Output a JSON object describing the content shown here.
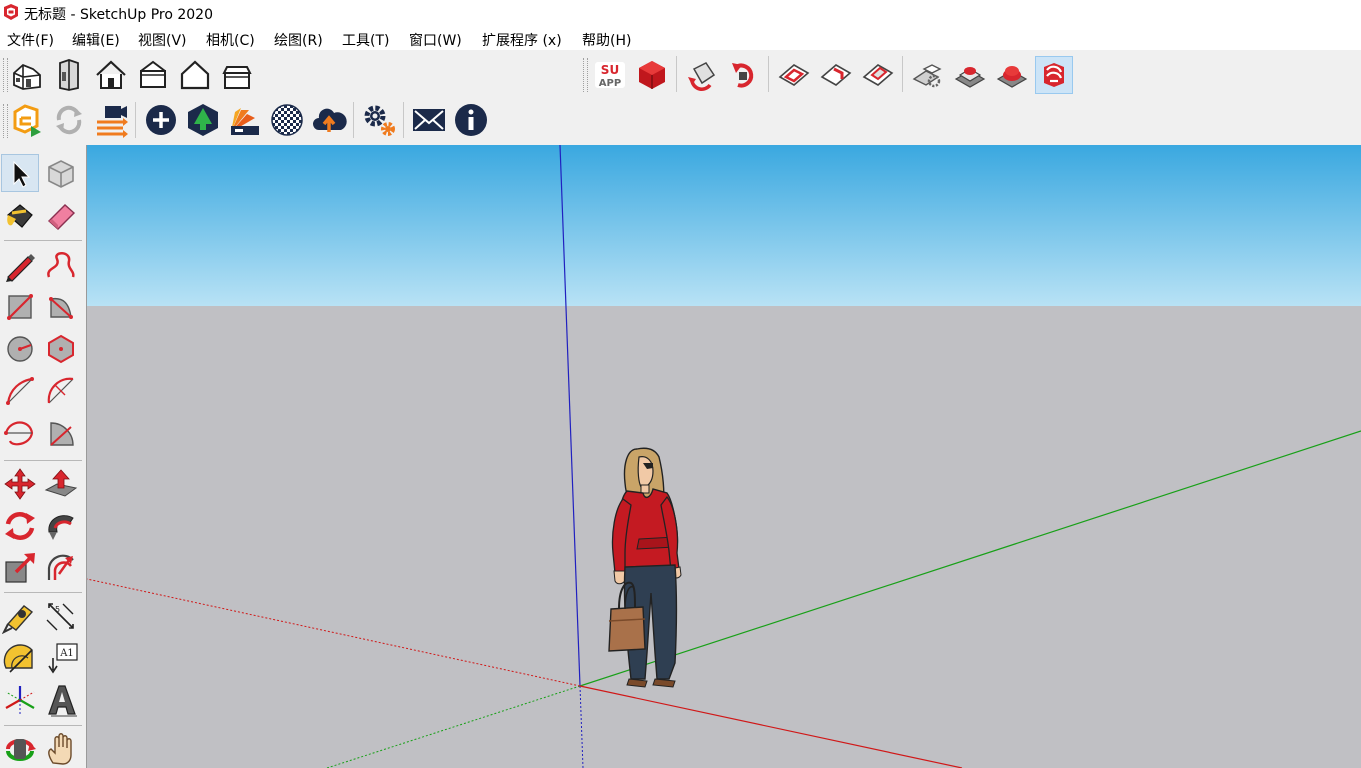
{
  "window": {
    "title": "无标题 - SketchUp Pro 2020",
    "icon": "sketchup-logo-icon"
  },
  "menu": {
    "items": [
      "文件(F)",
      "编辑(E)",
      "视图(V)",
      "相机(C)",
      "绘图(R)",
      "工具(T)",
      "窗口(W)",
      "扩展程序 (x)",
      "帮助(H)"
    ]
  },
  "toolbars": {
    "views": [
      "iso-view-icon",
      "front-back-view-icon",
      "top-view-icon",
      "front-view-icon",
      "right-view-icon",
      "back-view-icon"
    ],
    "extensions": [
      "su-app-icon",
      "red-cube-icon",
      "undo-arrow-icon",
      "redo-arrow-icon",
      "section-plane-icon",
      "section-display-icon",
      "section-cut-icon",
      "component-options-icon",
      "solid-tools-icon",
      "red-button-icon",
      "sketchup-icon"
    ],
    "extensions_active": "sketchup-icon",
    "su_app_label": [
      "SU",
      "APP"
    ],
    "warehouse": [
      "extension-manager-icon",
      "refresh-icon",
      "import-export-icon",
      "scene-camera-icon",
      "add-circle-icon",
      "tree-warehouse-icon",
      "material-swatch-icon",
      "checker-sphere-icon",
      "cloud-upload-icon",
      "settings-gears-icon",
      "mail-icon",
      "info-icon"
    ]
  },
  "left_tools": [
    [
      "select-arrow-icon",
      "make-component-icon"
    ],
    [
      "paint-bucket-icon",
      "eraser-icon"
    ],
    [
      "pencil-line-icon",
      "freehand-icon"
    ],
    [
      "rectangle-icon",
      "rotated-rectangle-icon"
    ],
    [
      "circle-icon",
      "polygon-icon"
    ],
    [
      "arc-icon",
      "two-point-arc-icon"
    ],
    [
      "three-point-arc-icon",
      "pie-icon"
    ],
    [
      "move-icon",
      "push-pull-icon"
    ],
    [
      "rotate-icon",
      "follow-me-icon"
    ],
    [
      "scale-icon",
      "offset-icon"
    ],
    [
      "tape-measure-icon",
      "dimension-icon"
    ],
    [
      "protractor-icon",
      "text-label-icon"
    ],
    [
      "axes-icon",
      "3d-text-icon"
    ],
    [
      "orbit-icon",
      "pan-hand-icon"
    ]
  ],
  "left_tools_active": "select-arrow-icon",
  "text_tool_label": "A1",
  "scene": {
    "sky_top": "#3aa8e0",
    "sky_bottom": "#b8e2f5",
    "ground": "#c0c0c4",
    "axis_red": "#d01818",
    "axis_green": "#18a018",
    "axis_blue": "#2020c0",
    "figure": "person-with-handbag"
  }
}
